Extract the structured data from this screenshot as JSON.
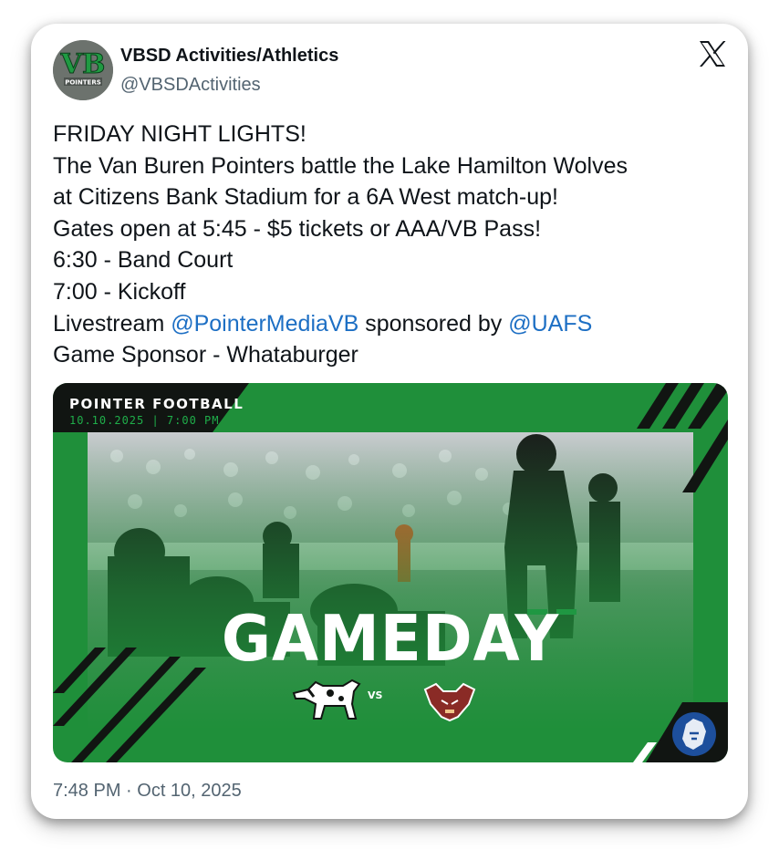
{
  "author": {
    "name": "VBSD Activities/Athletics",
    "handle": "@VBSDActivities",
    "avatar_text": "POINTERS"
  },
  "post": {
    "line1": "FRIDAY NIGHT LIGHTS!",
    "line2": "The Van Buren Pointers battle the Lake Hamilton Wolves",
    "line3": "at Citizens Bank Stadium for a 6A West match-up!",
    "line4": "Gates open at 5:45 - $5 tickets or AAA/VB Pass!",
    "line5": "6:30 - Band Court",
    "line6": "7:00 - Kickoff",
    "line7_prefix": "Livestream ",
    "line7_mention1": "@PointerMediaVB",
    "line7_middle": " sponsored by ",
    "line7_mention2": "@UAFS",
    "line8": "Game Sponsor - Whataburger"
  },
  "graphic": {
    "title": "POINTER FOOTBALL",
    "date": "10.10.2025 | 7:00 PM",
    "headline": "GAMEDAY",
    "vs": "VS"
  },
  "timestamp": "7:48 PM · Oct 10, 2025",
  "colors": {
    "brand_green": "#1f8f3a",
    "mention_blue": "#1d6fc4"
  },
  "icons": [
    "x-logo-icon",
    "pointer-dog-icon",
    "wolf-icon",
    "lion-badge-icon"
  ]
}
